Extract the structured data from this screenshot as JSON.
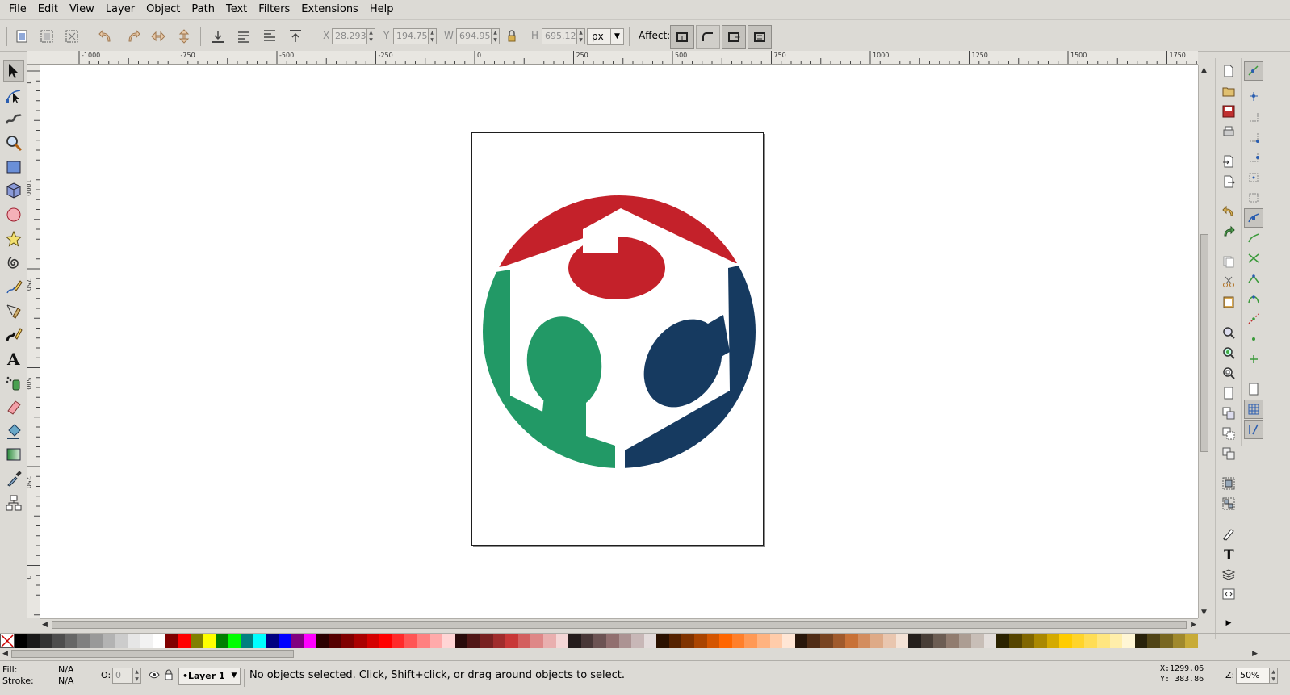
{
  "menu": [
    "File",
    "Edit",
    "View",
    "Layer",
    "Object",
    "Path",
    "Text",
    "Filters",
    "Extensions",
    "Help"
  ],
  "controls": {
    "x_label": "X",
    "x_value": "28.293",
    "y_label": "Y",
    "y_value": "194.753",
    "w_label": "W",
    "w_value": "694.957",
    "h_label": "H",
    "h_value": "695.122",
    "unit": "px",
    "affect_label": "Affect:"
  },
  "rulers": {
    "top": [
      "-1000",
      "-750",
      "-500",
      "-250",
      "0",
      "250",
      "500",
      "750",
      "1000",
      "1250",
      "1500",
      "1750"
    ],
    "left": [
      "1",
      "1000",
      "750",
      "500",
      "250",
      "0"
    ]
  },
  "logo_colors": {
    "red": "#c4212a",
    "green": "#229966",
    "blue": "#163a60"
  },
  "status": {
    "fill_label": "Fill:",
    "fill_value": "N/A",
    "stroke_label": "Stroke:",
    "stroke_value": "N/A",
    "opacity_label": "O:",
    "opacity_value": "0",
    "layer": "•Layer 1",
    "message": "No objects selected. Click, Shift+click, or drag around objects to select.",
    "cursor_x": "X:1299.06",
    "cursor_y": "Y: 383.86",
    "zoom_label": "Z:",
    "zoom_value": "50%"
  }
}
